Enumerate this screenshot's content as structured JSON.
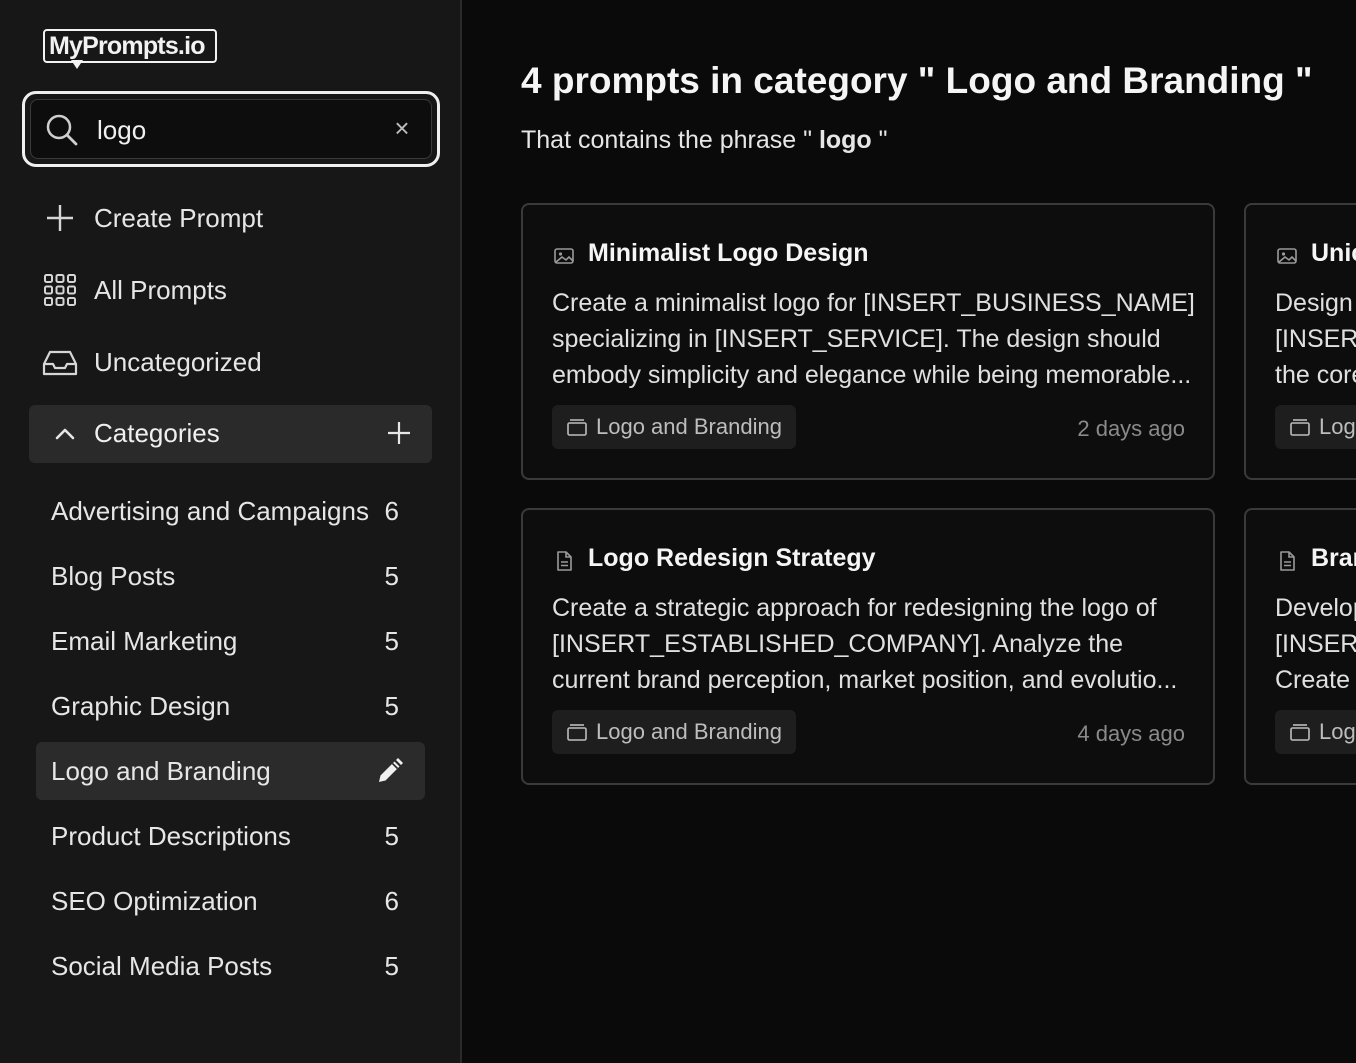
{
  "app": {
    "logo_text": "MyPrompts.io"
  },
  "search": {
    "value": "logo",
    "clear_glyph": "×"
  },
  "nav": {
    "create": {
      "label": "Create Prompt",
      "icon": "plus-icon"
    },
    "all": {
      "label": "All Prompts",
      "icon": "grid-icon"
    },
    "uncategorized": {
      "label": "Uncategorized",
      "icon": "inbox-icon"
    }
  },
  "categories": {
    "header": "Categories",
    "items": [
      {
        "name": "Advertising and Campaigns",
        "count": "6"
      },
      {
        "name": "Blog Posts",
        "count": "5"
      },
      {
        "name": "Email Marketing",
        "count": "5"
      },
      {
        "name": "Graphic Design",
        "count": "5"
      },
      {
        "name": "Logo and Branding",
        "count": "",
        "active": true
      },
      {
        "name": "Product Descriptions",
        "count": "5"
      },
      {
        "name": "SEO Optimization",
        "count": "6"
      },
      {
        "name": "Social Media Posts",
        "count": "5"
      }
    ]
  },
  "main": {
    "heading_prefix": "4 prompts in category \"",
    "heading_category": " Logo and Branding ",
    "heading_suffix": "\"",
    "sub_prefix": "That contains the phrase \" ",
    "sub_phrase": "logo",
    "sub_suffix": " \"",
    "cards": [
      {
        "title": "Minimalist Logo Design",
        "icon": "image-icon",
        "lines": [
          "Create a minimalist logo for [INSERT_BUSINESS_NAME]",
          "specializing in [INSERT_SERVICE]. The design should",
          "embody simplicity and elegance while being memorable..."
        ],
        "tag": "Logo and Branding",
        "date": "2 days ago"
      },
      {
        "title": "Unic",
        "icon": "image-icon",
        "lines": [
          "Design",
          "[INSERT",
          "the core"
        ],
        "tag": "Logo",
        "date": ""
      },
      {
        "title": "Logo Redesign Strategy",
        "icon": "document-icon",
        "lines": [
          "Create a strategic approach for redesigning the logo of",
          "[INSERT_ESTABLISHED_COMPANY]. Analyze the",
          "current brand perception, market position, and evolutio..."
        ],
        "tag": "Logo and Branding",
        "date": "4 days ago"
      },
      {
        "title": "Bran",
        "icon": "document-icon",
        "lines": [
          "Develop",
          "[INSERT",
          "Create"
        ],
        "tag": "Logo",
        "date": ""
      }
    ]
  },
  "colors": {
    "sidebar_bg": "#171717",
    "main_bg": "#0a0a0a",
    "active_bg": "#2b2b2b",
    "card_border": "#3a3a3a"
  }
}
